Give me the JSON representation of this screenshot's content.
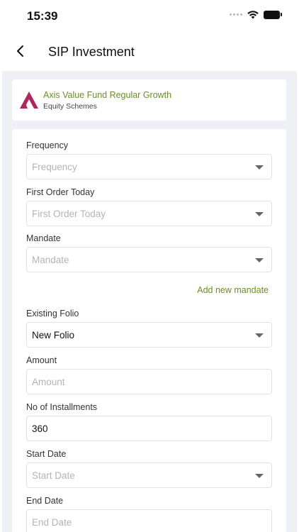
{
  "status_bar": {
    "time": "15:39",
    "icons": [
      "signal-dots-icon",
      "wifi-icon",
      "battery-icon"
    ]
  },
  "nav": {
    "title": "SIP Investment",
    "back_icon": "chevron-left-icon"
  },
  "fund": {
    "name": "Axis Value Fund Regular Growth",
    "category": "Equity Schemes",
    "logo_color": "#ae275f"
  },
  "form": {
    "frequency": {
      "label": "Frequency",
      "placeholder": "Frequency",
      "value": ""
    },
    "first_order": {
      "label": "First Order Today",
      "placeholder": "First Order Today",
      "value": ""
    },
    "mandate": {
      "label": "Mandate",
      "placeholder": "Mandate",
      "value": ""
    },
    "add_mandate_label": "Add new mandate",
    "existing_folio": {
      "label": "Existing Folio",
      "value": "New Folio"
    },
    "amount": {
      "label": "Amount",
      "placeholder": "Amount",
      "value": ""
    },
    "installments": {
      "label": "No of Installments",
      "value": "360"
    },
    "start_date": {
      "label": "Start Date",
      "placeholder": "Start Date",
      "value": ""
    },
    "end_date": {
      "label": "End Date",
      "placeholder": "End Date",
      "value": ""
    }
  },
  "colors": {
    "accent": "#6b8e23",
    "background": "#eff0f6",
    "placeholder": "#b4b4b8"
  }
}
